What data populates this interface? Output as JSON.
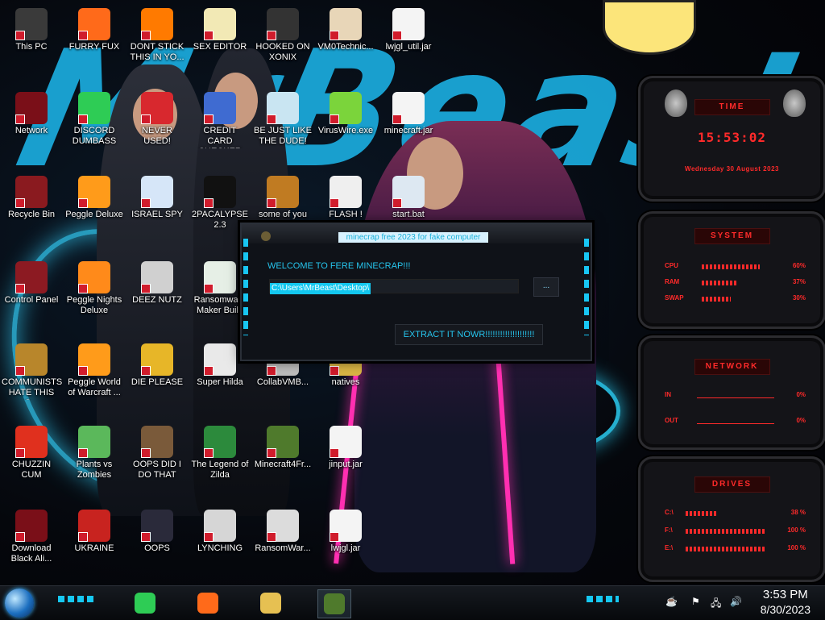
{
  "desktop": {
    "icons": [
      {
        "label": "This PC",
        "icon": "computer-icon",
        "color": "#3a3a3a"
      },
      {
        "label": "FURRY FUX",
        "icon": "firefox-icon",
        "color": "#ff6a1a"
      },
      {
        "label": "DONT STICK THIS IN YO...",
        "icon": "traffic-cone-icon",
        "color": "#ff7a00"
      },
      {
        "label": "SEX EDITOR",
        "icon": "hex-editor-icon",
        "color": "#f2e9b5"
      },
      {
        "label": "HOOKED ON XONIX",
        "icon": "xonix-icon",
        "color": "#333333"
      },
      {
        "label": "VM0Technic...",
        "icon": "doctor-icon",
        "color": "#e8d6b8"
      },
      {
        "label": "lwjgl_util.jar",
        "icon": "java-icon",
        "color": "#f4f4f4"
      },
      {
        "label": "Network",
        "icon": "network-icon",
        "color": "#7a0f18"
      },
      {
        "label": "DISCORD DUMBASS",
        "icon": "chat-icon",
        "color": "#2ecc55"
      },
      {
        "label": "NEVER USED!",
        "icon": "dev-icon",
        "color": "#d8282e"
      },
      {
        "label": "CREDIT CARD CHECKER",
        "icon": "credit-card-icon",
        "color": "#3f6bd1"
      },
      {
        "label": "BE JUST LIKE THE DUDE!",
        "icon": "santa-icon",
        "color": "#c9e5f2"
      },
      {
        "label": "VirusWire.exe",
        "icon": "lime-icon",
        "color": "#7bd43b"
      },
      {
        "label": "minecraft.jar",
        "icon": "java-icon",
        "color": "#f4f4f4"
      },
      {
        "label": "Recycle Bin",
        "icon": "recycle-bin-icon",
        "color": "#8a1a1f"
      },
      {
        "label": "Peggle Deluxe",
        "icon": "peggle-icon",
        "color": "#ff9b1a"
      },
      {
        "label": "ISRAEL SPY",
        "icon": "network-drive-icon",
        "color": "#d6e6f8"
      },
      {
        "label": "2PACALYPSE 2.3",
        "icon": "terminal-icon",
        "color": "#111111"
      },
      {
        "label": "some of you",
        "icon": "beaver-icon",
        "color": "#c07b22"
      },
      {
        "label": "FLASH !",
        "icon": "flash-icon",
        "color": "#efefef"
      },
      {
        "label": "start.bat",
        "icon": "gear-file-icon",
        "color": "#dde8f2"
      },
      {
        "label": "Control Panel",
        "icon": "control-panel-icon",
        "color": "#8c1a22"
      },
      {
        "label": "Peggle Nights Deluxe",
        "icon": "peggle-icon",
        "color": "#ff8a1a"
      },
      {
        "label": "DEEZ NUTZ",
        "icon": "window-stack-icon",
        "color": "#d0d0d0"
      },
      {
        "label": "Ransomware Maker Build",
        "icon": "window-icon",
        "color": "#e6efe6"
      },
      {
        "label": "COMMUNISTS HATE THIS G...",
        "icon": "money-bag-icon",
        "color": "#b8862b"
      },
      {
        "label": "Peggle World of Warcraft ...",
        "icon": "peggle-icon",
        "color": "#ff9b1a"
      },
      {
        "label": "DIE PLEASE",
        "icon": "de-icon",
        "color": "#e7b628"
      },
      {
        "label": "Super Hilda",
        "icon": "pixel-cat-icon",
        "color": "#e9e9e9"
      },
      {
        "label": "CollabVMB...",
        "icon": "file-icon",
        "color": "#bcbcbc"
      },
      {
        "label": "natives",
        "icon": "folder-icon",
        "color": "#d9b544"
      },
      {
        "label": "CHUZZIN CUM",
        "icon": "chuzzle-icon",
        "color": "#e0301e"
      },
      {
        "label": "Plants vs Zombies",
        "icon": "plant-icon",
        "color": "#5bb85b"
      },
      {
        "label": "OOPS DID I DO THAT",
        "icon": "portrait-icon",
        "color": "#7a5a3a"
      },
      {
        "label": "The Legend of Zilda",
        "icon": "hero-icon",
        "color": "#2c8a3c"
      },
      {
        "label": "Minecraft4Fr...",
        "icon": "grass-block-icon",
        "color": "#4f7a2c"
      },
      {
        "label": "jinput.jar",
        "icon": "java-icon",
        "color": "#f4f4f4"
      },
      {
        "label": "Download Black Ali...",
        "icon": "alien-icon",
        "color": "#7a0f18"
      },
      {
        "label": "UKRAINE",
        "icon": "radiation-icon",
        "color": "#c8231f"
      },
      {
        "label": "OOPS",
        "icon": "book-icon",
        "color": "#2a2a3a"
      },
      {
        "label": "LYNCHING",
        "icon": "rope-icon",
        "color": "#d6d6d6"
      },
      {
        "label": "RansomWar...",
        "icon": "skull-icon",
        "color": "#dcdcdc"
      },
      {
        "label": "lwjgl.jar",
        "icon": "java-icon",
        "color": "#f4f4f4"
      }
    ]
  },
  "dialog": {
    "title": "minecrap free 2023 for fake computer",
    "welcome": "WELCOME TO FERE MINECRAP!!!",
    "path_value": "C:\\Users\\MrBeast\\Desktop\\",
    "browse_label": "...",
    "extract_label": "EXTRACT IT NOWR!!!!!!!!!!!!!!!!!!!!"
  },
  "gadgets": {
    "time": {
      "title": "TIME",
      "clock": "15:53:02",
      "date": "Wednesday 30 August 2023"
    },
    "system": {
      "title": "SYSTEM",
      "rows": [
        {
          "label": "CPU",
          "value": "60%",
          "level": 0.6
        },
        {
          "label": "RAM",
          "value": "37%",
          "level": 0.37
        },
        {
          "label": "SWAP",
          "value": "30%",
          "level": 0.3
        }
      ]
    },
    "network": {
      "title": "NETWORK",
      "rows": [
        {
          "label": "IN",
          "value": "0%"
        },
        {
          "label": "OUT",
          "value": "0%"
        }
      ]
    },
    "drives": {
      "title": "DRIVES",
      "rows": [
        {
          "label": "C:\\",
          "value": "38 %",
          "level": 0.38
        },
        {
          "label": "F:\\",
          "value": "100 %",
          "level": 1.0
        },
        {
          "label": "E:\\",
          "value": "100 %",
          "level": 1.0
        }
      ]
    },
    "accent_color": "#ff2a2a"
  },
  "taskbar": {
    "start_icon": "start-orb-icon",
    "pinned": [
      {
        "icon": "chat-icon",
        "color": "#2ecc55",
        "active": false
      },
      {
        "icon": "firefox-icon",
        "color": "#ff6a1a",
        "active": false
      },
      {
        "icon": "file-explorer-icon",
        "color": "#e6c052",
        "active": false
      },
      {
        "icon": "grass-block-icon",
        "color": "#4f7a2c",
        "active": true
      }
    ],
    "tray_icons": [
      "java-icon",
      "flag-icon",
      "network-icon",
      "volume-icon"
    ],
    "time": "3:53 PM",
    "date": "8/30/2023"
  }
}
